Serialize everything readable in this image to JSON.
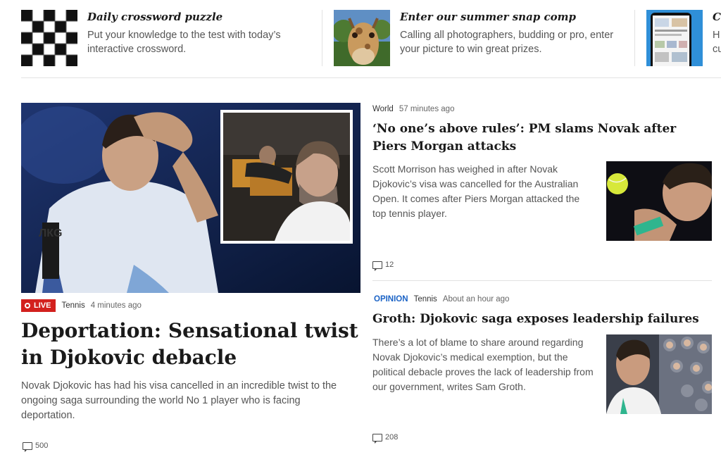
{
  "promos": [
    {
      "title": "Daily crossword puzzle",
      "desc": "Put your knowledge to the test with today’s interactive crossword."
    },
    {
      "title": "Enter our summer snap comp",
      "desc": "Calling all photographers, budding or pro, enter your picture to win great prizes."
    },
    {
      "title": "C",
      "desc": "H\ncu"
    }
  ],
  "lead": {
    "badge": "LIVE",
    "category": "Tennis",
    "time": "4 minutes ago",
    "title": "Deportation: Sensational twist in Djokovic debacle",
    "summary": "Novak Djokovic has had his visa cancelled in an incredible twist to the ongoing saga surrounding the world No 1 player who is facing deportation.",
    "comments": "500",
    "shirt_text": "ЛКG"
  },
  "story1": {
    "category": "World",
    "time": "57 minutes ago",
    "title": "‘No one’s above rules’: PM slams Novak after Piers Morgan attacks",
    "summary": "Scott Morrison has weighed in after Novak Djokovic’s visa was cancelled for the Australian Open. It comes after Piers Morgan attacked the top tennis player.",
    "comments": "12"
  },
  "story2": {
    "label": "OPINION",
    "category": "Tennis",
    "time": "About an hour ago",
    "title": "Groth: Djokovic saga exposes leadership failures",
    "summary": "There’s a lot of blame to share around regarding Novak Djokovic’s medical exemption, but the political debacle proves the lack of leadership from our government, writes Sam Groth.",
    "comments": "208"
  },
  "colors": {
    "live": "#d3211e",
    "opinion": "#1b63c6",
    "text": "#1a1a1a",
    "muted": "#555555"
  }
}
